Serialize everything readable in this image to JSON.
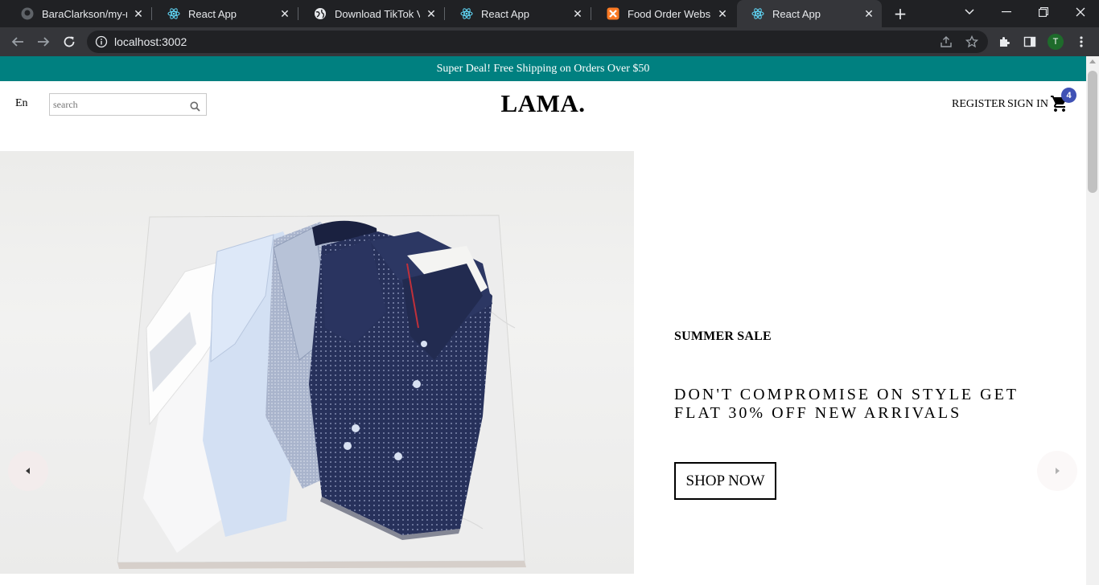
{
  "browser": {
    "tabs": [
      {
        "title": "BaraClarkson/my-reac",
        "icon": "github-icon",
        "active": false
      },
      {
        "title": "React App",
        "icon": "react-icon",
        "active": false
      },
      {
        "title": "Download TikTok Vide",
        "icon": "globe-icon",
        "active": false
      },
      {
        "title": "React App",
        "icon": "react-icon",
        "active": false
      },
      {
        "title": "Food Order Website -",
        "icon": "xampp-icon",
        "active": false
      },
      {
        "title": "React App",
        "icon": "react-icon",
        "active": true
      }
    ],
    "url": "localhost:3002",
    "profile_initial": "T"
  },
  "announcement": {
    "text": "Super Deal! Free Shipping on Orders Over $50"
  },
  "navbar": {
    "language": "En",
    "search_placeholder": "search",
    "logo": "LAMA.",
    "register_label": "REGISTER",
    "signin_label": "SIGN IN",
    "cart_count": "4"
  },
  "slide": {
    "title": "SUMMER SALE",
    "description": "DON'T COMPROMISE ON STYLE GET FLAT 30% OFF NEW ARRIVALS",
    "button_label": "SHOP NOW",
    "image_alt": "folded dress shirts on marble",
    "background": "#ffffff"
  },
  "colors": {
    "announcement_bg": "#008080",
    "badge_bg": "#3f51b5",
    "arrow_bg": "#f4ecec"
  }
}
